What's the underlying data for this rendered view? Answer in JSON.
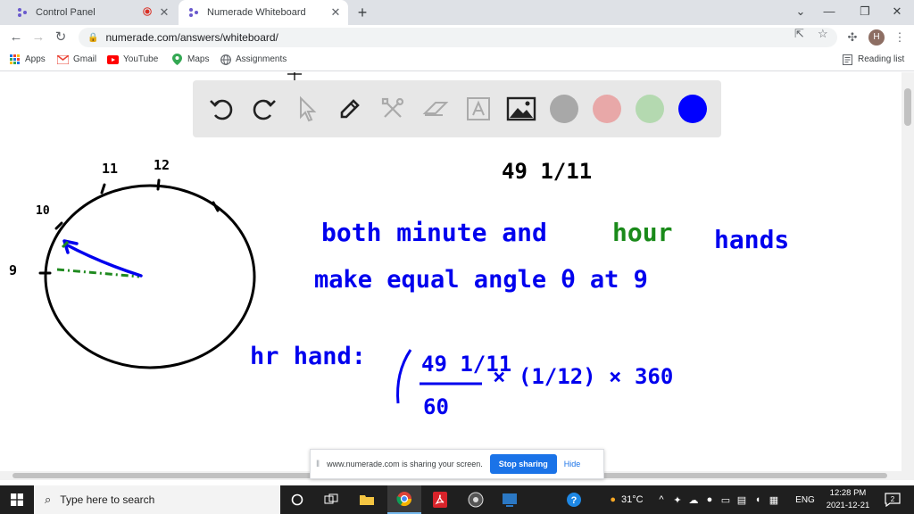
{
  "browser": {
    "tabs": [
      {
        "label": "Control Panel",
        "recording": true
      },
      {
        "label": "Numerade Whiteboard",
        "active": true
      }
    ],
    "url": "numerade.com/answers/whiteboard/",
    "profile_initial": "H",
    "bookmarks": [
      {
        "label": "Apps",
        "icon": "apps-grid-icon"
      },
      {
        "label": "Gmail",
        "icon": "gmail-icon"
      },
      {
        "label": "YouTube",
        "icon": "youtube-icon"
      },
      {
        "label": "Maps",
        "icon": "maps-icon"
      },
      {
        "label": "Assignments",
        "icon": "globe-icon"
      }
    ],
    "reading_list": "Reading list"
  },
  "whiteboard": {
    "colors": {
      "gray": "#a8a8a8",
      "pink": "#e8a8a8",
      "green": "#b4d9b0",
      "blue": "#0000ff"
    },
    "handwriting": {
      "top_time": "49 1/11",
      "line1_parts": [
        "both minute and",
        "hour",
        "hands"
      ],
      "line2": "make equal angle θ at 9",
      "formula_label": "hr hand:",
      "formula_num": "49 1/11",
      "formula_den": "60",
      "formula_rest": "× (1/12) × 360",
      "clock_labels": [
        "11",
        "12",
        "10",
        "9"
      ]
    }
  },
  "share": {
    "message": "www.numerade.com is sharing your screen.",
    "stop_label": "Stop sharing",
    "hide_label": "Hide"
  },
  "taskbar": {
    "search_placeholder": "Type here to search",
    "weather": "31°C",
    "language": "ENG",
    "time": "12:28 PM",
    "date": "2021-12-21",
    "notifications": "2"
  }
}
